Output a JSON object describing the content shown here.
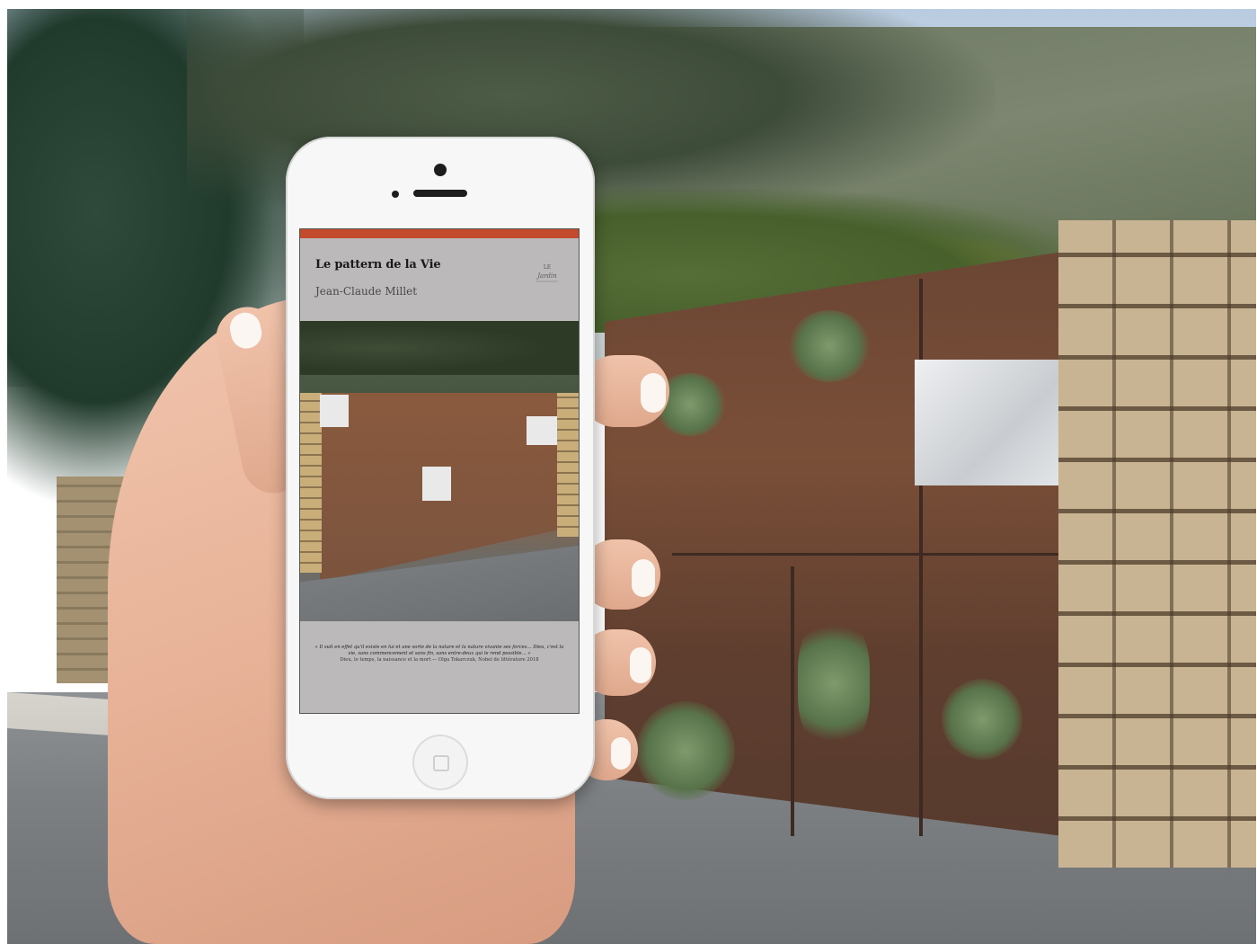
{
  "book": {
    "title": "Le pattern de la Vie",
    "author": "Jean-Claude Millet",
    "publisher_logo_text": "LE JARDIN",
    "quote": "« Il suit en effet qu'il existe en lui et une sorte de la nature et la nature vivante ses forces… Dieu, c'est la vie, sans commencement et sans fin, sans entre-deux qui le rend possible… »",
    "quote_source": "Dieu, le temps, la naissance et la mort — Olga Tokarczuk, Nobel de littérature 2018"
  },
  "colors": {
    "accent_bar": "#c34a2c",
    "screen_bg": "#bbb9b9",
    "rust": "#7a4f38"
  }
}
